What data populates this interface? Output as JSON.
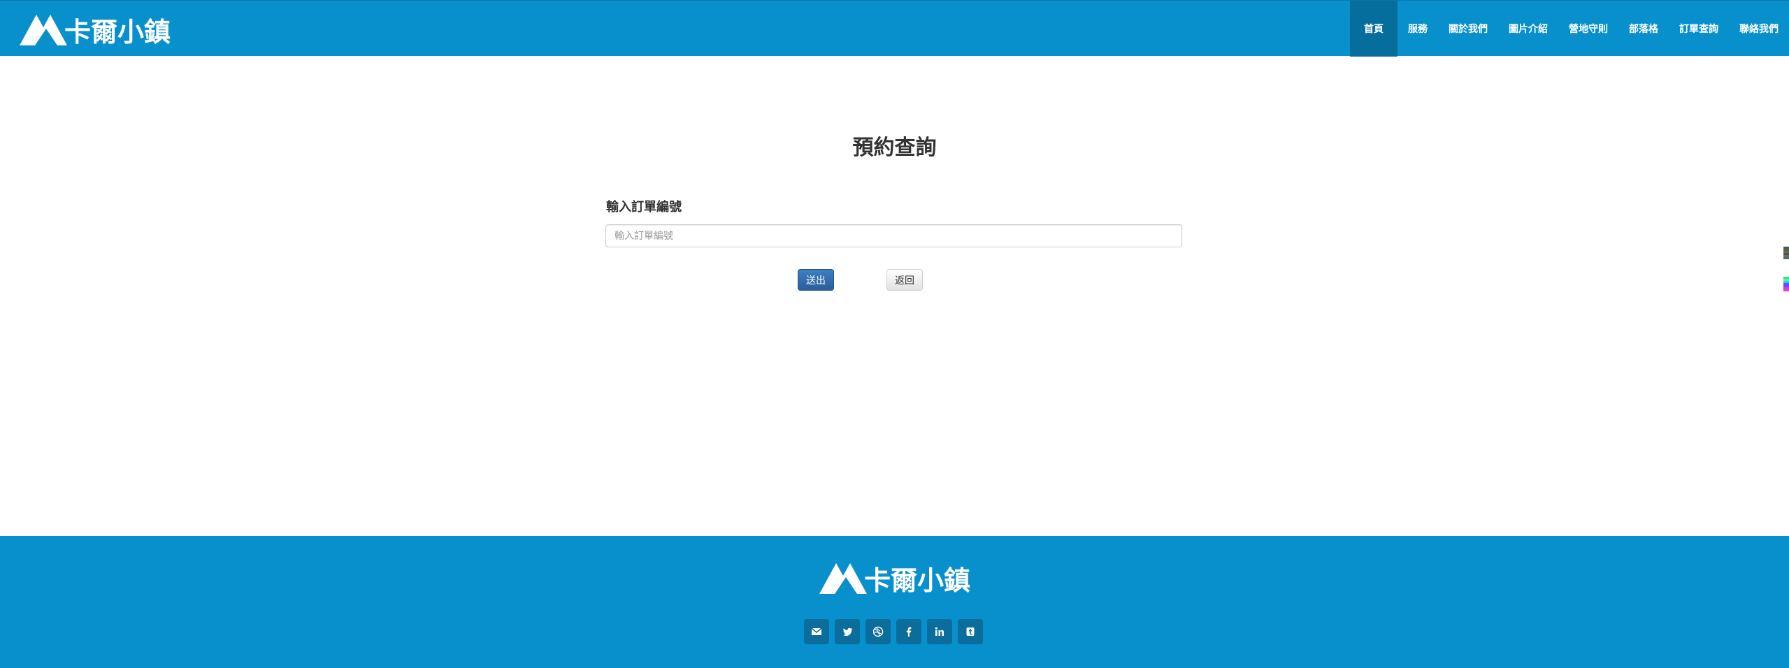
{
  "header": {
    "logo_text": "卡爾小鎮",
    "nav": [
      {
        "label": "首頁",
        "active": true
      },
      {
        "label": "服務"
      },
      {
        "label": "關於我們"
      },
      {
        "label": "圖片介紹"
      },
      {
        "label": "營地守則"
      },
      {
        "label": "部落格"
      },
      {
        "label": "訂單查詢"
      },
      {
        "label": "聯絡我們"
      }
    ]
  },
  "main": {
    "title": "預約查詢",
    "order_label": "輸入訂單編號",
    "order_input": {
      "value": "",
      "placeholder": "輸入訂單編號"
    },
    "submit_label": "送出",
    "back_label": "返回"
  },
  "footer": {
    "logo_text": "卡爾小鎮",
    "socials": [
      "envelope-icon",
      "twitter-icon",
      "dribbble-icon",
      "facebook-icon",
      "linkedin-icon",
      "tumblr-icon"
    ]
  },
  "colors": {
    "brand_blue": "#0790cc",
    "nav_active": "#066e9c",
    "submit_blue": "#2f6aa8"
  }
}
